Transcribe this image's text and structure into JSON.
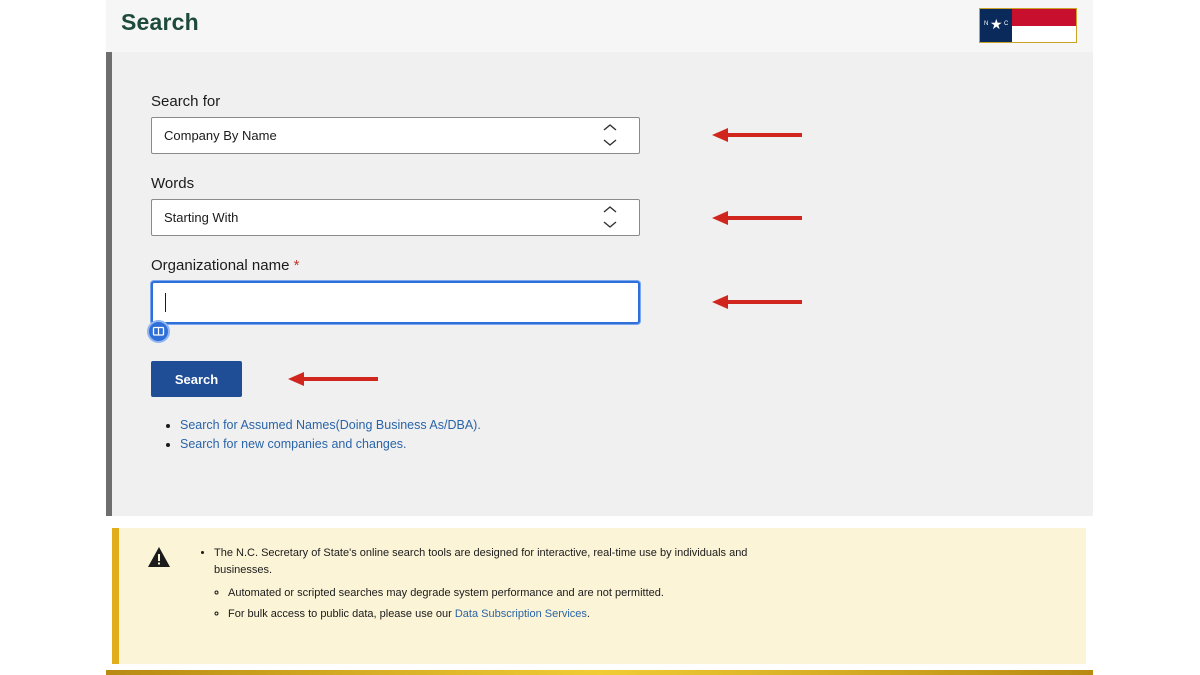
{
  "header": {
    "title": "Search"
  },
  "form": {
    "search_for": {
      "label": "Search for",
      "value": "Company By Name"
    },
    "words": {
      "label": "Words",
      "value": "Starting With"
    },
    "org_name": {
      "label": "Organizational name",
      "required_mark": "*",
      "value": ""
    },
    "search_button": "Search"
  },
  "links": [
    {
      "text": "Search for Assumed Names(Doing Business As/DBA)."
    },
    {
      "text": "Search for new companies and changes."
    }
  ],
  "notice": {
    "main_pre": "The N.C. Secretary of State's online search tools are designed for interactive, real-time use by individuals and businesses.",
    "sub1": "Automated or scripted searches may degrade system performance and are not permitted.",
    "sub2_pre": "For bulk access to public data, please use our ",
    "sub2_link": "Data Subscription Services",
    "sub2_post": "."
  },
  "colors": {
    "title_green": "#1e4a3c",
    "button_blue": "#1f4e96",
    "link_blue": "#2a64a8",
    "arrow_red": "#d0261e",
    "notice_bg": "#fbf4d7",
    "notice_border": "#e1ad1b"
  },
  "icons": [
    "updown-icon",
    "helper-icon",
    "warning-icon",
    "arrow-annotation",
    "flag-logo"
  ]
}
